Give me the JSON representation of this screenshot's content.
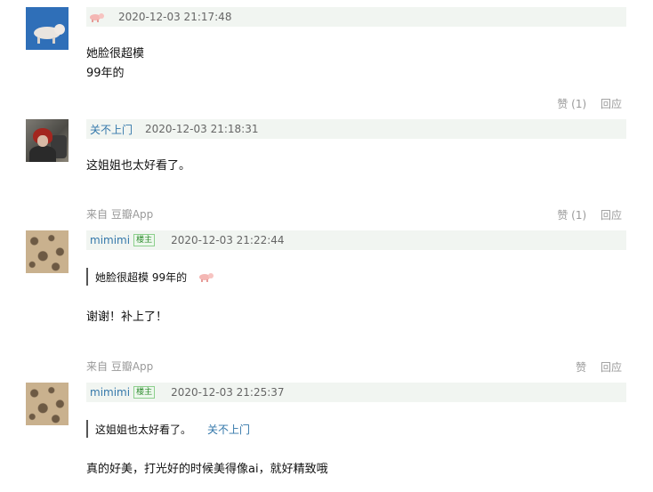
{
  "comments": [
    {
      "avatar_icon": "pig-avatar-icon",
      "name": "",
      "timestamp": "2020-12-03 21:17:48",
      "lines": [
        "她脸很超模",
        "99年的"
      ],
      "like_label": "赞 (1)",
      "reply_label": "回应"
    },
    {
      "avatar_icon": "person-avatar-icon",
      "name": "关不上门",
      "timestamp": "2020-12-03 21:18:31",
      "lines": [
        "这姐姐也太好看了。"
      ],
      "source": "来自 豆瓣App",
      "like_label": "赞 (1)",
      "reply_label": "回应"
    },
    {
      "avatar_icon": "leopard-avatar-icon",
      "name": "mimimi",
      "badge": "楼主",
      "timestamp": "2020-12-03 21:22:44",
      "quote_text": "她脸很超模 99年的",
      "lines": [
        "谢谢！补上了！"
      ],
      "source": "来自 豆瓣App",
      "like_label": "赞",
      "reply_label": "回应"
    },
    {
      "avatar_icon": "leopard-avatar-icon",
      "name": "mimimi",
      "badge": "楼主",
      "timestamp": "2020-12-03 21:25:37",
      "quote_text": "这姐姐也太好看了。",
      "quote_author": "关不上门",
      "lines": [
        "真的好美，打光好的时候美得像ai，就好精致哦"
      ]
    }
  ]
}
